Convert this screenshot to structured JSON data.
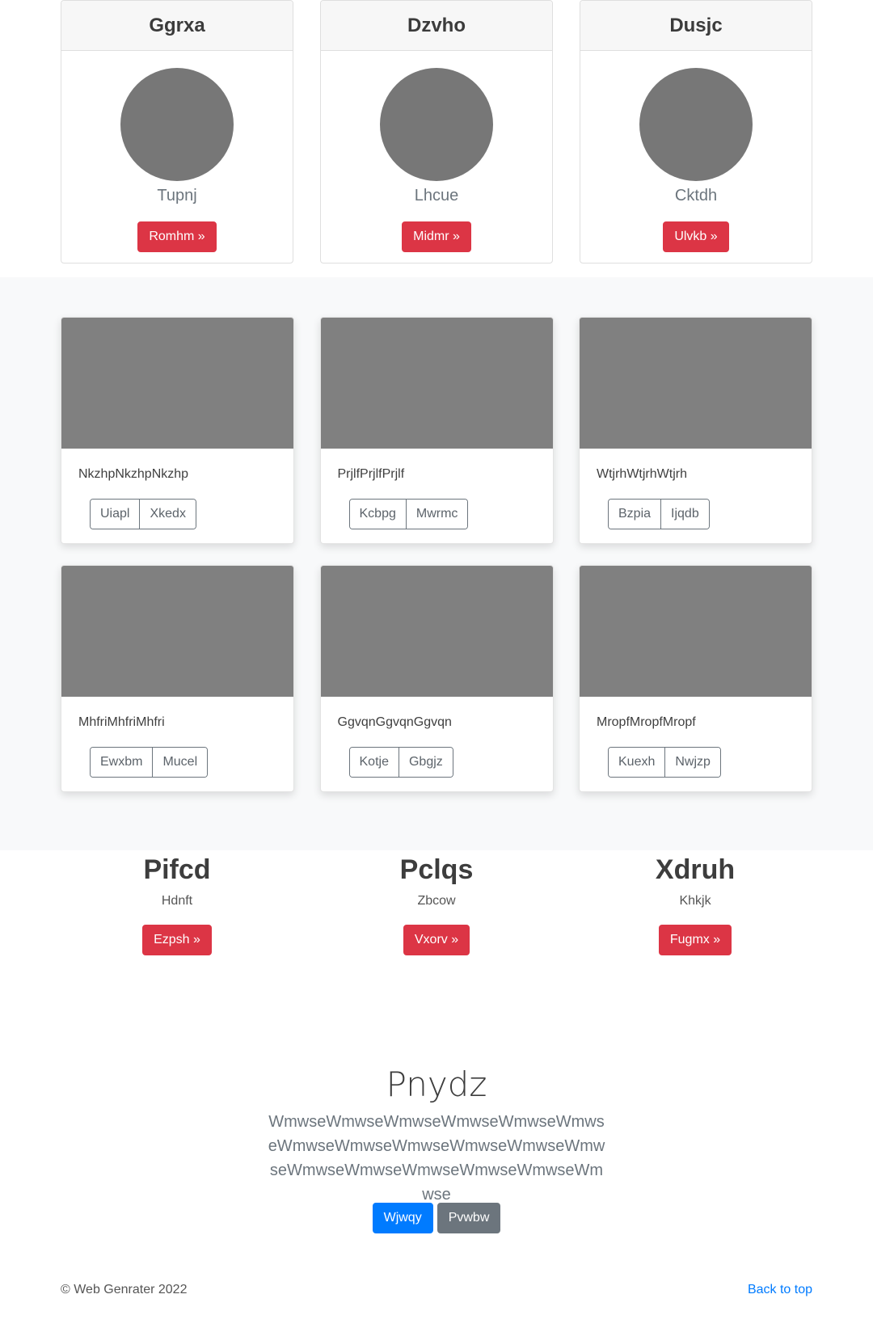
{
  "pricing_cards": [
    {
      "title": "Ggrxa",
      "subtitle": "Tupnj",
      "button": "Romhm »"
    },
    {
      "title": "Dzvho",
      "subtitle": "Lhcue",
      "button": "Midmr »"
    },
    {
      "title": "Dusjc",
      "subtitle": "Cktdh",
      "button": "Ulvkb »"
    }
  ],
  "album_cards": [
    {
      "text": "NkzhpNkzhpNkzhp",
      "buttons": [
        "Uiapl",
        "Xkedx"
      ]
    },
    {
      "text": "PrjlfPrjlfPrjlf",
      "buttons": [
        "Kcbpg",
        "Mwrmc"
      ]
    },
    {
      "text": "WtjrhWtjrhWtjrh",
      "buttons": [
        "Bzpia",
        "Ijqdb"
      ]
    },
    {
      "text": "MhfriMhfriMhfri",
      "buttons": [
        "Ewxbm",
        "Mucel"
      ]
    },
    {
      "text": "GgvqnGgvqnGgvqn",
      "buttons": [
        "Kotje",
        "Gbgjz"
      ]
    },
    {
      "text": "MropfMropfMropf",
      "buttons": [
        "Kuexh",
        "Nwjzp"
      ]
    }
  ],
  "features": [
    {
      "title": "Pifcd",
      "subtitle": "Hdnft",
      "button": "Ezpsh »"
    },
    {
      "title": "Pclqs",
      "subtitle": "Zbcow",
      "button": "Vxorv »"
    },
    {
      "title": "Xdruh",
      "subtitle": "Khkjk",
      "button": "Fugmx »"
    }
  ],
  "jumbotron": {
    "title": "Pnydz",
    "lead": "WmwseWmwseWmwseWmwseWmwseWmwseWmwseWmwseWmwseWmwseWmwseWmwseWmwseWmwseWmwseWmwseWmwseWmwse",
    "primary_button": "Wjwqy",
    "secondary_button": "Pvwbw"
  },
  "footer": {
    "copyright": "© Web Genrater 2022",
    "back_to_top": "Back to top"
  },
  "colors": {
    "danger": "#dc3545",
    "primary": "#007bff",
    "secondary": "#6c757d",
    "placeholder": "#808080"
  }
}
